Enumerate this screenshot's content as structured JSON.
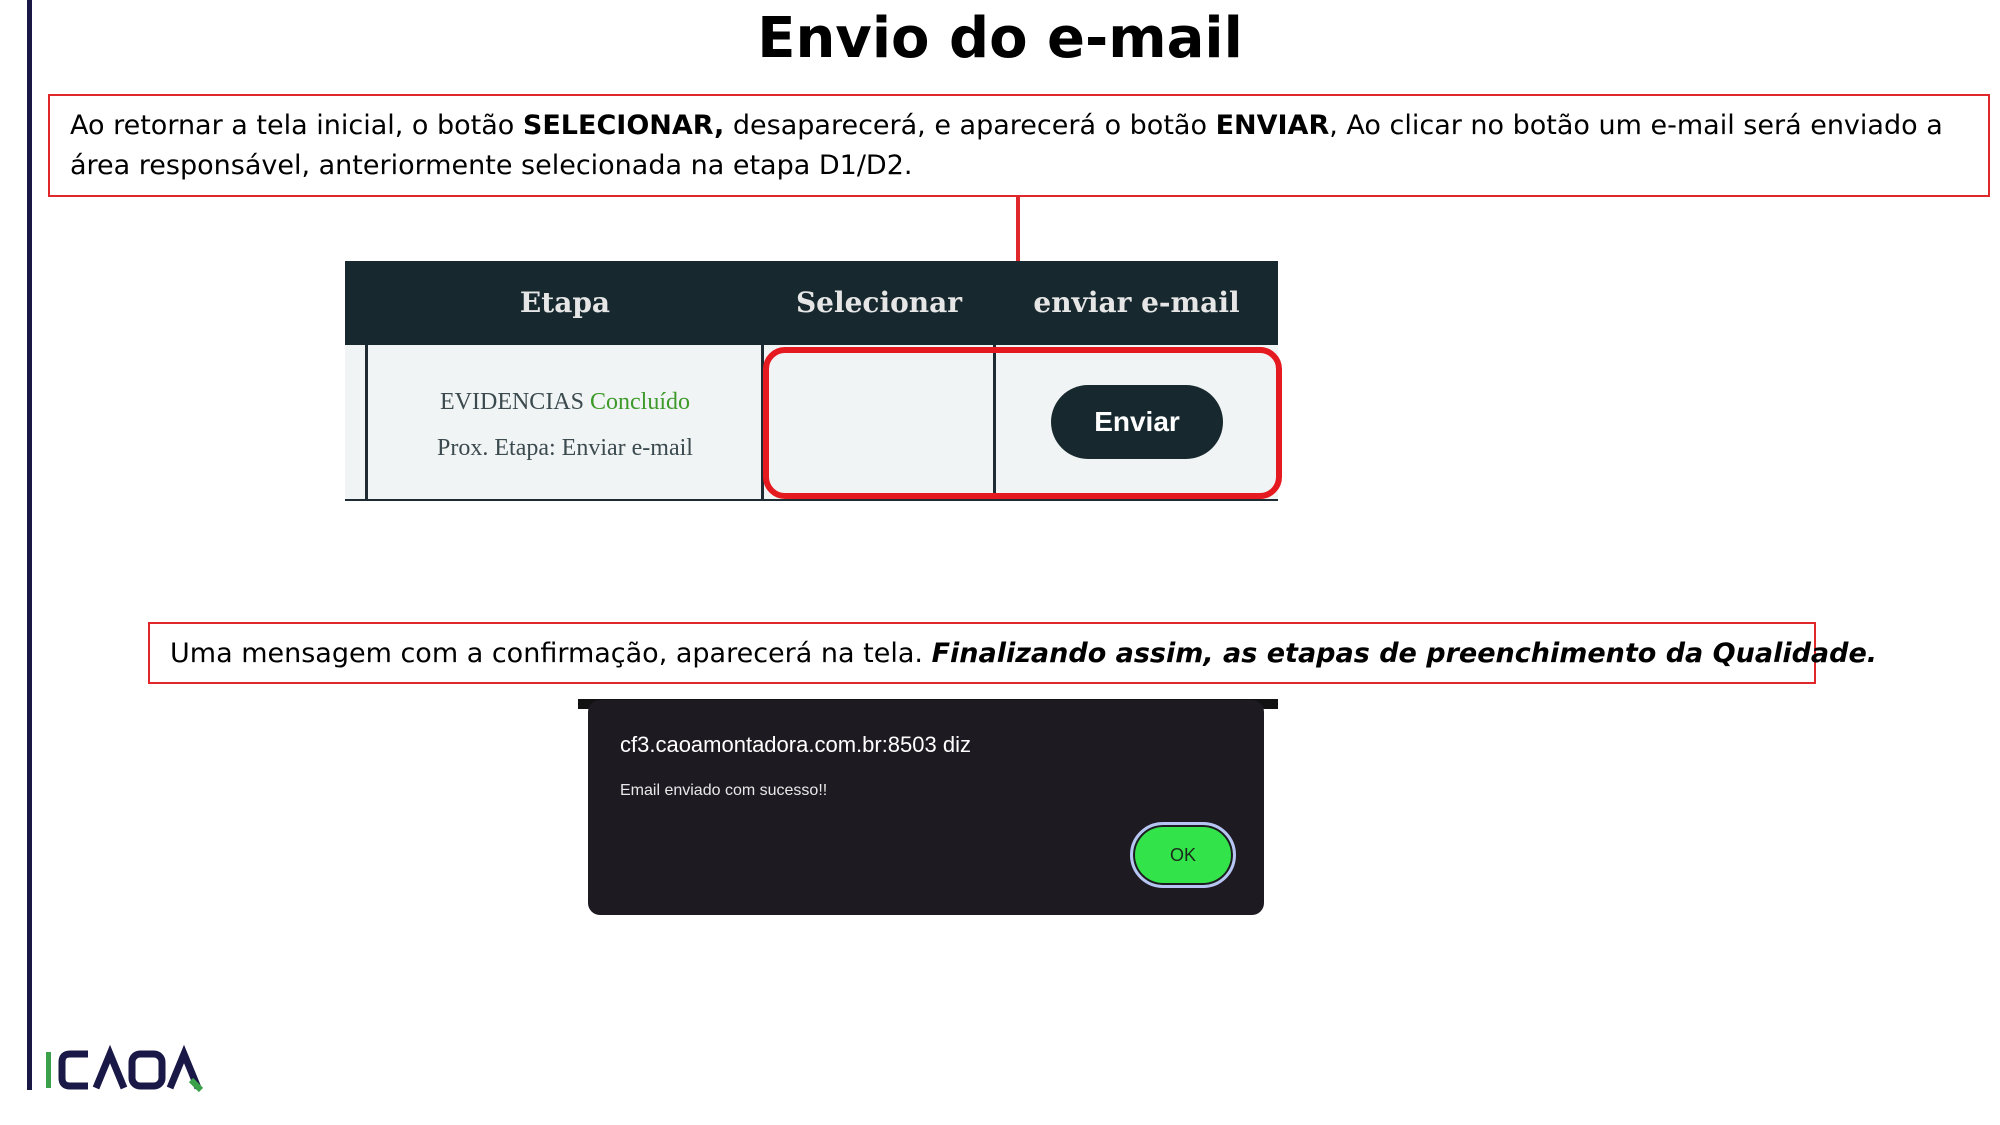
{
  "page": {
    "title": "Envio do e-mail"
  },
  "callout_top": {
    "part1": "Ao retornar a tela inicial, o botão ",
    "bold1": "SELECIONAR,",
    "part2": " desaparecerá, e aparecerá o botão ",
    "bold2": "ENVIAR",
    "part3": ", Ao clicar no botão um e-mail será enviado a área responsável, anteriormente selecionada na etapa D1/D2."
  },
  "table": {
    "headers": [
      "Etapa",
      "Selecionar",
      "enviar e-mail"
    ],
    "row": {
      "etapa_name": "EVIDENCIAS",
      "etapa_status": "Concluído",
      "next_step": "Prox. Etapa: Enviar e-mail",
      "enviar_button": "Enviar"
    }
  },
  "callout_bottom": {
    "text": "Uma mensagem com a confirmação, aparecerá na tela. ",
    "emphasis": "Finalizando assim, as etapas de preenchimento da Qualidade."
  },
  "dialog": {
    "title": "cf3.caoamontadora.com.br:8503 diz",
    "message": "Email enviado com sucesso!!",
    "ok_button": "OK"
  },
  "logo": {
    "text": "CAOA",
    "icon": "caoa-logo"
  },
  "colors": {
    "accent_red": "#e0282c",
    "table_header": "#17292f",
    "status_green": "#3d9a2a",
    "ok_green": "#33e34a",
    "logo_navy": "#1a1846",
    "logo_green": "#3aa14a"
  }
}
